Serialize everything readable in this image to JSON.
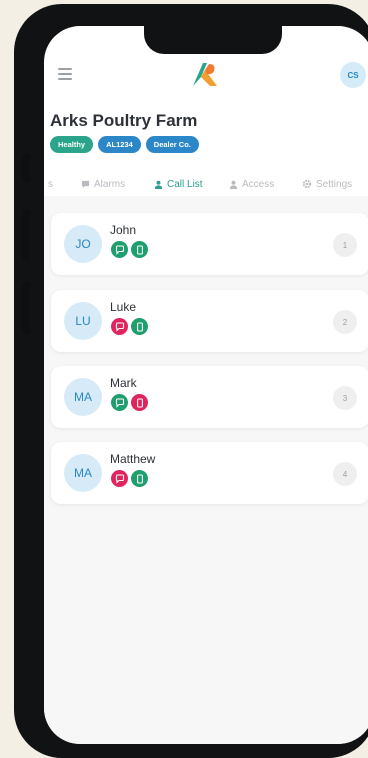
{
  "topbar": {
    "avatar_initials": "CS"
  },
  "farm": {
    "title": "Arks Poultry Farm",
    "badges": [
      {
        "label": "Healthy",
        "color": "#2aa58c"
      },
      {
        "label": "AL1234",
        "color": "#2c87c8"
      },
      {
        "label": "Dealer Co.",
        "color": "#2c87c8"
      }
    ]
  },
  "tabs": [
    {
      "label": "s",
      "icon": "partial-tab-icon"
    },
    {
      "label": "Alarms",
      "icon": "alarm-bubble-icon"
    },
    {
      "label": "Call List",
      "icon": "person-icon",
      "active": true
    },
    {
      "label": "Access",
      "icon": "person-icon"
    },
    {
      "label": "Settings",
      "icon": "gear-icon"
    }
  ],
  "contacts": [
    {
      "initials": "JO",
      "name": "John",
      "order": "1",
      "sms_color": "#1f9f6d",
      "call_color": "#1f9f6d"
    },
    {
      "initials": "LU",
      "name": "Luke",
      "order": "2",
      "sms_color": "#e0245e",
      "call_color": "#1f9f6d"
    },
    {
      "initials": "MA",
      "name": "Mark",
      "order": "3",
      "sms_color": "#1f9f6d",
      "call_color": "#e0245e"
    },
    {
      "initials": "MA",
      "name": "Matthew",
      "order": "4",
      "sms_color": "#e0245e",
      "call_color": "#1f9f6d"
    }
  ],
  "colors": {
    "accent": "#2a9d8f",
    "avatar_bg": "#d6ebf7",
    "avatar_text": "#2b86c5"
  }
}
